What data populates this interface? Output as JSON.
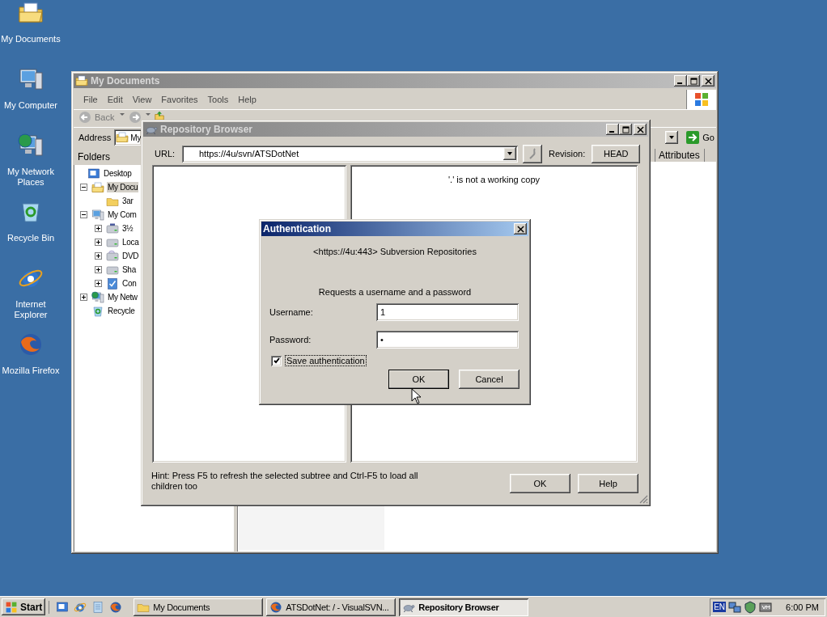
{
  "desktop_icons": [
    {
      "label": "My Documents",
      "kind": "documents"
    },
    {
      "label": "My Computer",
      "kind": "computer"
    },
    {
      "label": "My Network Places",
      "kind": "network"
    },
    {
      "label": "Recycle Bin",
      "kind": "recycle"
    },
    {
      "label": "Internet Explorer",
      "kind": "ie"
    },
    {
      "label": "Mozilla Firefox",
      "kind": "firefox"
    }
  ],
  "explorer": {
    "title": "My Documents",
    "menu": [
      "File",
      "Edit",
      "View",
      "Favorites",
      "Tools",
      "Help"
    ],
    "back": "Back",
    "address_label": "Address",
    "address": "My",
    "go": "Go",
    "folders_header": "Folders",
    "columns": [
      "Attributes"
    ],
    "tree": [
      {
        "label": "Desktop",
        "kind": "desktop",
        "selected": false,
        "children": [
          {
            "label": "My Docu",
            "kind": "documents",
            "selected": true,
            "expanded": true,
            "children": [
              {
                "label": "3ar",
                "kind": "folder",
                "selected": false
              }
            ]
          },
          {
            "label": "My Com",
            "kind": "computer",
            "selected": false,
            "expanded": true,
            "children": [
              {
                "label": "3½",
                "kind": "floppy",
                "selected": false,
                "expanded": false
              },
              {
                "label": "Loca",
                "kind": "drive",
                "selected": false,
                "expanded": false
              },
              {
                "label": "DVD",
                "kind": "cdrom",
                "selected": false,
                "expanded": false
              },
              {
                "label": "Sha",
                "kind": "drive",
                "selected": false,
                "expanded": false
              },
              {
                "label": "Con",
                "kind": "control",
                "selected": false,
                "expanded": false
              }
            ]
          },
          {
            "label": "My Netw",
            "kind": "network",
            "selected": false,
            "expanded": false
          },
          {
            "label": "Recycle",
            "kind": "recycle",
            "selected": false
          }
        ]
      }
    ]
  },
  "repo_browser": {
    "title": "Repository Browser",
    "url_label": "URL:",
    "url": "https://4u/svn/ATSDotNet",
    "revision_label": "Revision:",
    "revision": "HEAD",
    "message": "'.' is not a working copy",
    "hint": "Hint: Press F5 to refresh the selected subtree and Ctrl-F5 to load all children too",
    "buttons": [
      "OK",
      "Help"
    ]
  },
  "auth": {
    "title": "Authentication",
    "realm": "<https://4u:443> Subversion Repositories",
    "prompt": "Requests a username and a password",
    "username_label": "Username:",
    "username": "1",
    "password_label": "Password:",
    "password": "•",
    "save": {
      "label": "Save authentication",
      "checked": true
    },
    "buttons": [
      "OK",
      "Cancel"
    ]
  },
  "taskbar": {
    "start": "Start",
    "quick_launch": [
      {
        "kind": "desktop"
      },
      {
        "kind": "ie"
      },
      {
        "kind": "page"
      },
      {
        "kind": "firefox"
      }
    ],
    "tasks": [
      {
        "label": "My Documents",
        "kind": "folder",
        "selected": false
      },
      {
        "label": "ATSDotNet: / - VisualSVN...",
        "kind": "firefox",
        "selected": false
      },
      {
        "label": "Repository Browser",
        "kind": "repo",
        "selected": true
      }
    ],
    "language": "EN",
    "clock": "6:00 PM"
  }
}
